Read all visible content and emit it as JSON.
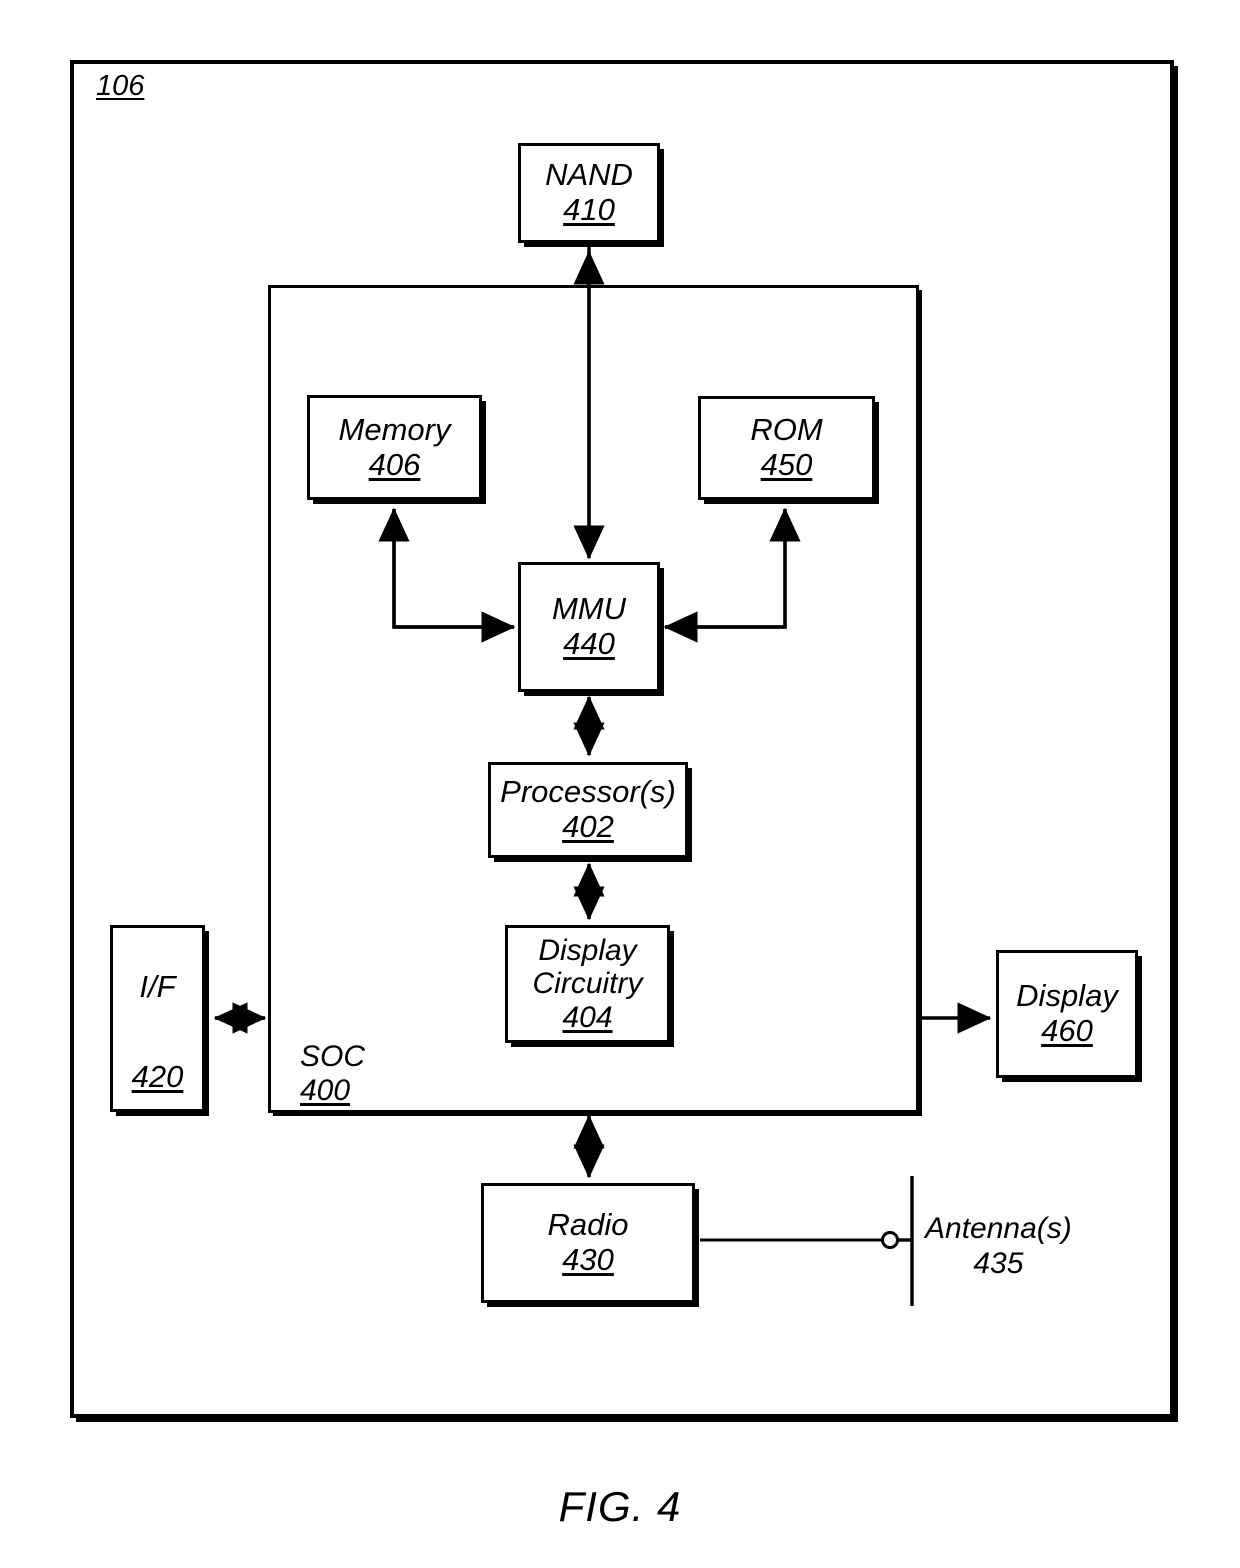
{
  "figure": {
    "caption": "FIG. 4",
    "device_ref": "106"
  },
  "soc": {
    "label": "SOC",
    "number": "400"
  },
  "blocks": {
    "nand": {
      "label": "NAND",
      "number": "410"
    },
    "memory": {
      "label": "Memory",
      "number": "406"
    },
    "rom": {
      "label": "ROM",
      "number": "450"
    },
    "mmu": {
      "label": "MMU",
      "number": "440"
    },
    "processor": {
      "label": "Processor(s)",
      "number": "402"
    },
    "display_circuitry": {
      "label_line1": "Display",
      "label_line2": "Circuitry",
      "number": "404"
    },
    "interface": {
      "label": "I/F",
      "number": "420"
    },
    "display": {
      "label": "Display",
      "number": "460"
    },
    "radio": {
      "label": "Radio",
      "number": "430"
    },
    "antenna": {
      "label": "Antenna(s)",
      "number": "435"
    }
  },
  "colors": {
    "stroke": "#000000",
    "background": "#ffffff"
  }
}
